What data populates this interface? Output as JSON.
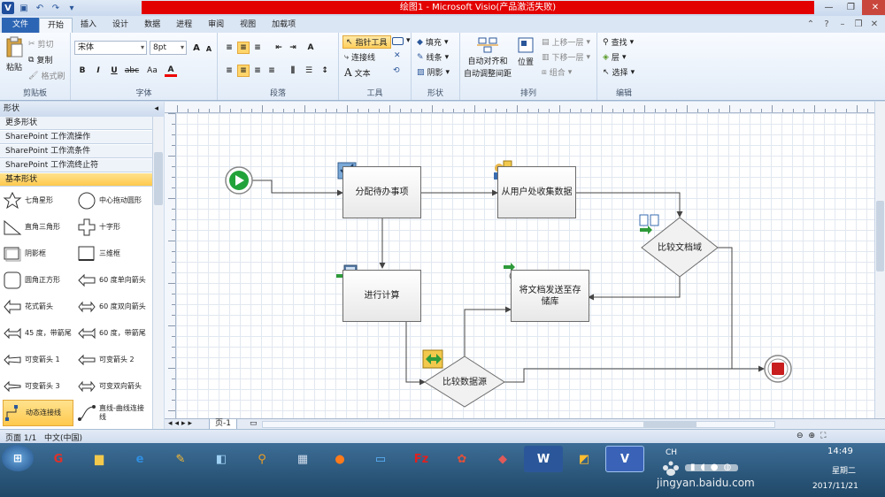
{
  "window": {
    "title": "绘图1 - Microsoft Visio(产品激活失败)",
    "tabs": [
      {
        "label": "文件",
        "kind": "file"
      },
      {
        "label": "开始",
        "kind": "active"
      },
      {
        "label": "插入"
      },
      {
        "label": "设计"
      },
      {
        "label": "数据"
      },
      {
        "label": "进程"
      },
      {
        "label": "审阅"
      },
      {
        "label": "视图"
      },
      {
        "label": "加载项"
      }
    ]
  },
  "ribbon": {
    "clipboard": {
      "label": "剪贴板",
      "paste": "粘贴",
      "cut": "剪切",
      "copy": "复制",
      "format_painter": "格式刷"
    },
    "font": {
      "label": "字体",
      "name": "宋体",
      "size": "8pt",
      "bold": "B",
      "italic": "I",
      "underline": "U",
      "strike": "abc",
      "case": "Aa",
      "color": "A"
    },
    "paragraph": {
      "label": "段落"
    },
    "tools": {
      "label": "工具",
      "pointer": "指针工具",
      "connector": "连接线",
      "text": "文本"
    },
    "shape": {
      "label": "形状",
      "fill": "填充",
      "line": "线条",
      "shadow": "阴影"
    },
    "arrange": {
      "label": "排列",
      "auto_align": "自动对齐和",
      "auto_space": "自动调整间距",
      "position": "位置",
      "bring_forward": "上移一层",
      "send_backward": "下移一层",
      "group": "组合"
    },
    "editing": {
      "label": "编辑",
      "find": "查找",
      "layers": "层",
      "select": "选择"
    }
  },
  "shapes_pane": {
    "title": "形状",
    "stencils": [
      "更多形状",
      "SharePoint 工作流操作",
      "SharePoint 工作流条件",
      "SharePoint 工作流终止符",
      "基本形状"
    ],
    "selected_stencil": "基本形状",
    "items": [
      "七角星形",
      "中心拖动圆形",
      "直角三角形",
      "十字形",
      "阴影框",
      "三维框",
      "圆角正方形",
      "60 度单向箭头",
      "花式箭头",
      "60 度双向箭头",
      "45 度，带箭尾",
      "60 度，带箭尾",
      "可变箭头 1",
      "可变箭头 2",
      "可变箭头 3",
      "可变双向箭头",
      "动态连接线",
      "直线-曲线连接线"
    ],
    "selected_item": "动态连接线"
  },
  "diagram": {
    "nodes": {
      "assign": "分配待办事项",
      "collect": "从用户处收集数据",
      "compare_doc": "比较文档域",
      "calc": "进行计算",
      "send": "将文档发送至存储库",
      "compare_src": "比较数据源"
    }
  },
  "pagebar": {
    "page_tab": "页-1"
  },
  "status": {
    "page": "页面 1/1",
    "language": "中文(中国)"
  },
  "taskbar": {
    "tray_lang": "CH",
    "time": "14:49",
    "weekday": "星期二",
    "date": "2017/11/21",
    "watermark_url": "jingyan.baidu.com",
    "watermark_logo": "Baidu 经验"
  },
  "colors": {
    "title_red": "#e30000",
    "file_tab": "#2c65b4",
    "selection": "#ffc94d",
    "start_green": "#22a33a",
    "end_red": "#c81e1e"
  }
}
